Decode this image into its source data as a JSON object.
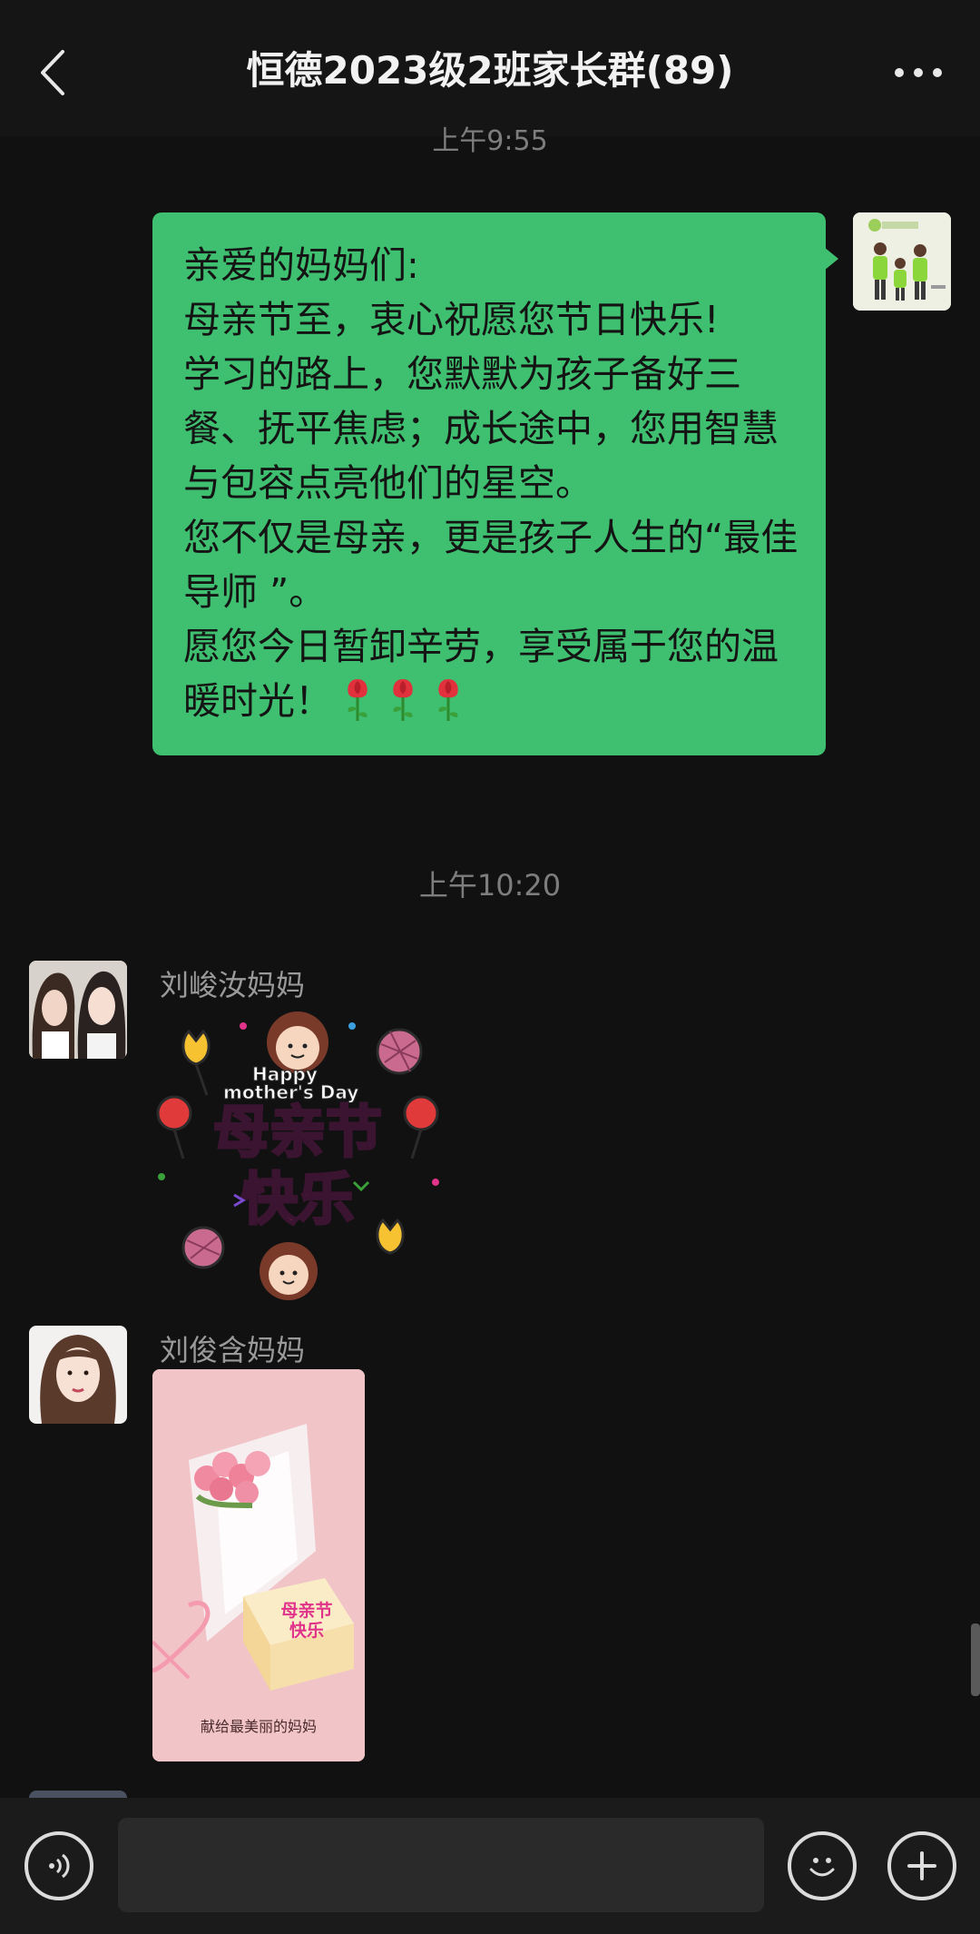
{
  "header": {
    "title": "恒德2023级2班家长群(89)"
  },
  "messages": {
    "time_top": "上午9:55",
    "outgoing": {
      "lines": [
        "亲爱的妈妈们:",
        "母亲节至，衷心祝愿您节日快乐!",
        "学习的路上，您默默为孩子备好三餐、抚平焦虑；成长途中，您用智慧与包容点亮他们的星空。",
        "您不仅是母亲，更是孩子人生的“最佳导师 ”。",
        "愿您今日暂卸辛劳，享受属于您的温暖时光！"
      ]
    },
    "time_mid": "上午10:20",
    "incoming": [
      {
        "sender": "刘峻汝妈妈",
        "sticker_text_en": "Happy mother's Day",
        "sticker_text_zh_1": "母亲节",
        "sticker_text_zh_2": "快乐"
      },
      {
        "sender": "刘俊含妈妈",
        "cake_text_1": "母亲节",
        "cake_text_2": "快乐",
        "photo_caption": "献给最美丽的妈妈"
      }
    ]
  },
  "colors": {
    "background": "#111111",
    "bubble_green": "#3fbf70"
  }
}
